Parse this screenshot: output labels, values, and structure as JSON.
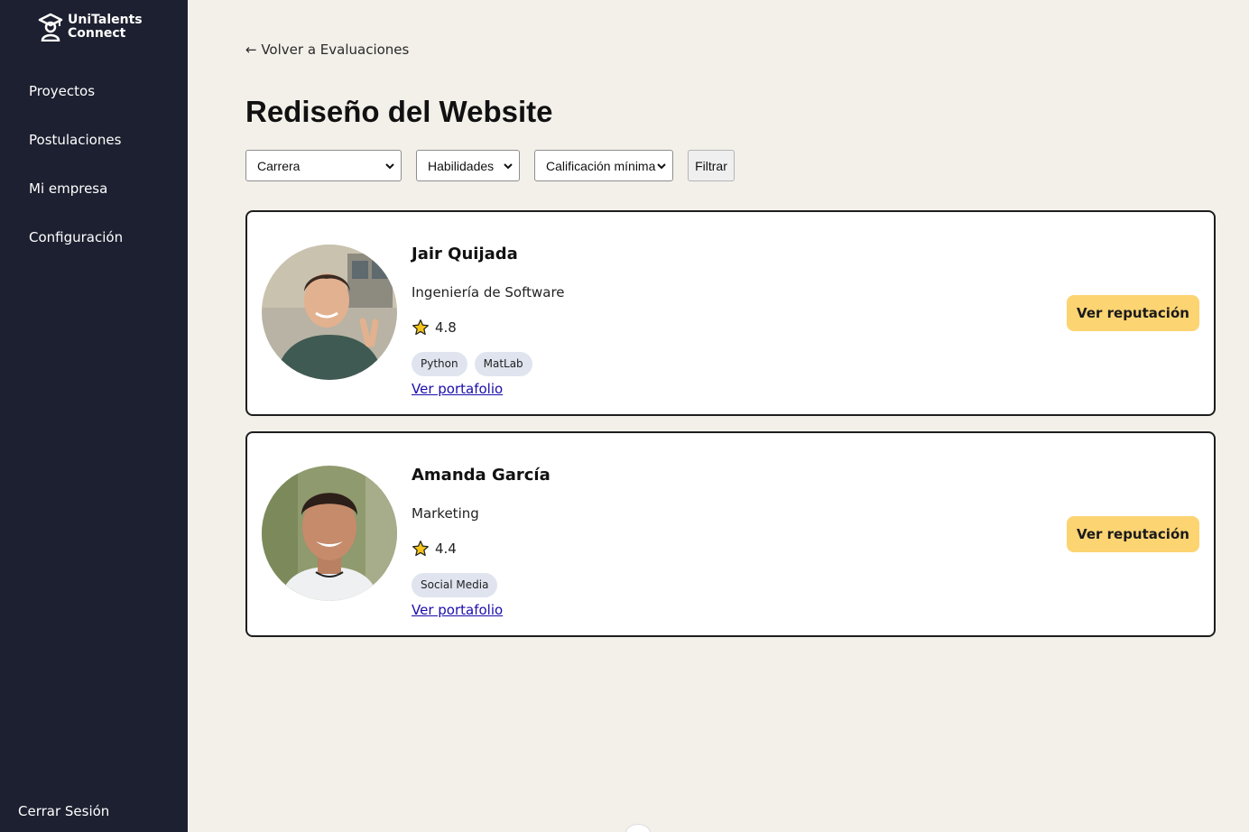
{
  "app": {
    "logo_line1": "UniTalents",
    "logo_line2": "Connect",
    "logo_icon": "graduate-icon"
  },
  "sidebar": {
    "items": [
      {
        "label": "Proyectos"
      },
      {
        "label": "Postulaciones"
      },
      {
        "label": "Mi empresa"
      },
      {
        "label": "Configuración"
      }
    ],
    "logout_label": "Cerrar Sesión"
  },
  "main": {
    "back_label": "← Volver a Evaluaciones",
    "title": "Rediseño del Website",
    "filters": {
      "career": "Carrera",
      "skills": "Habilidades",
      "min_rating": "Calificación mínima",
      "filter_button": "Filtrar"
    },
    "candidates": [
      {
        "name": "Jair Quijada",
        "career": "Ingeniería de Software",
        "rating": "4.8",
        "tags": [
          "Python",
          "MatLab"
        ],
        "portfolio_label": "Ver portafolio",
        "reputation_label": "Ver reputación"
      },
      {
        "name": "Amanda García",
        "career": "Marketing",
        "rating": "4.4",
        "tags": [
          "Social Media"
        ],
        "portfolio_label": "Ver portafolio",
        "reputation_label": "Ver reputación"
      }
    ]
  },
  "colors": {
    "sidebar_bg": "#1d2030",
    "page_bg": "#f3f0ea",
    "accent_button": "#fcd472",
    "tag_bg": "#dfe4ef",
    "link": "#1a0dab",
    "star": "#f5c518"
  }
}
